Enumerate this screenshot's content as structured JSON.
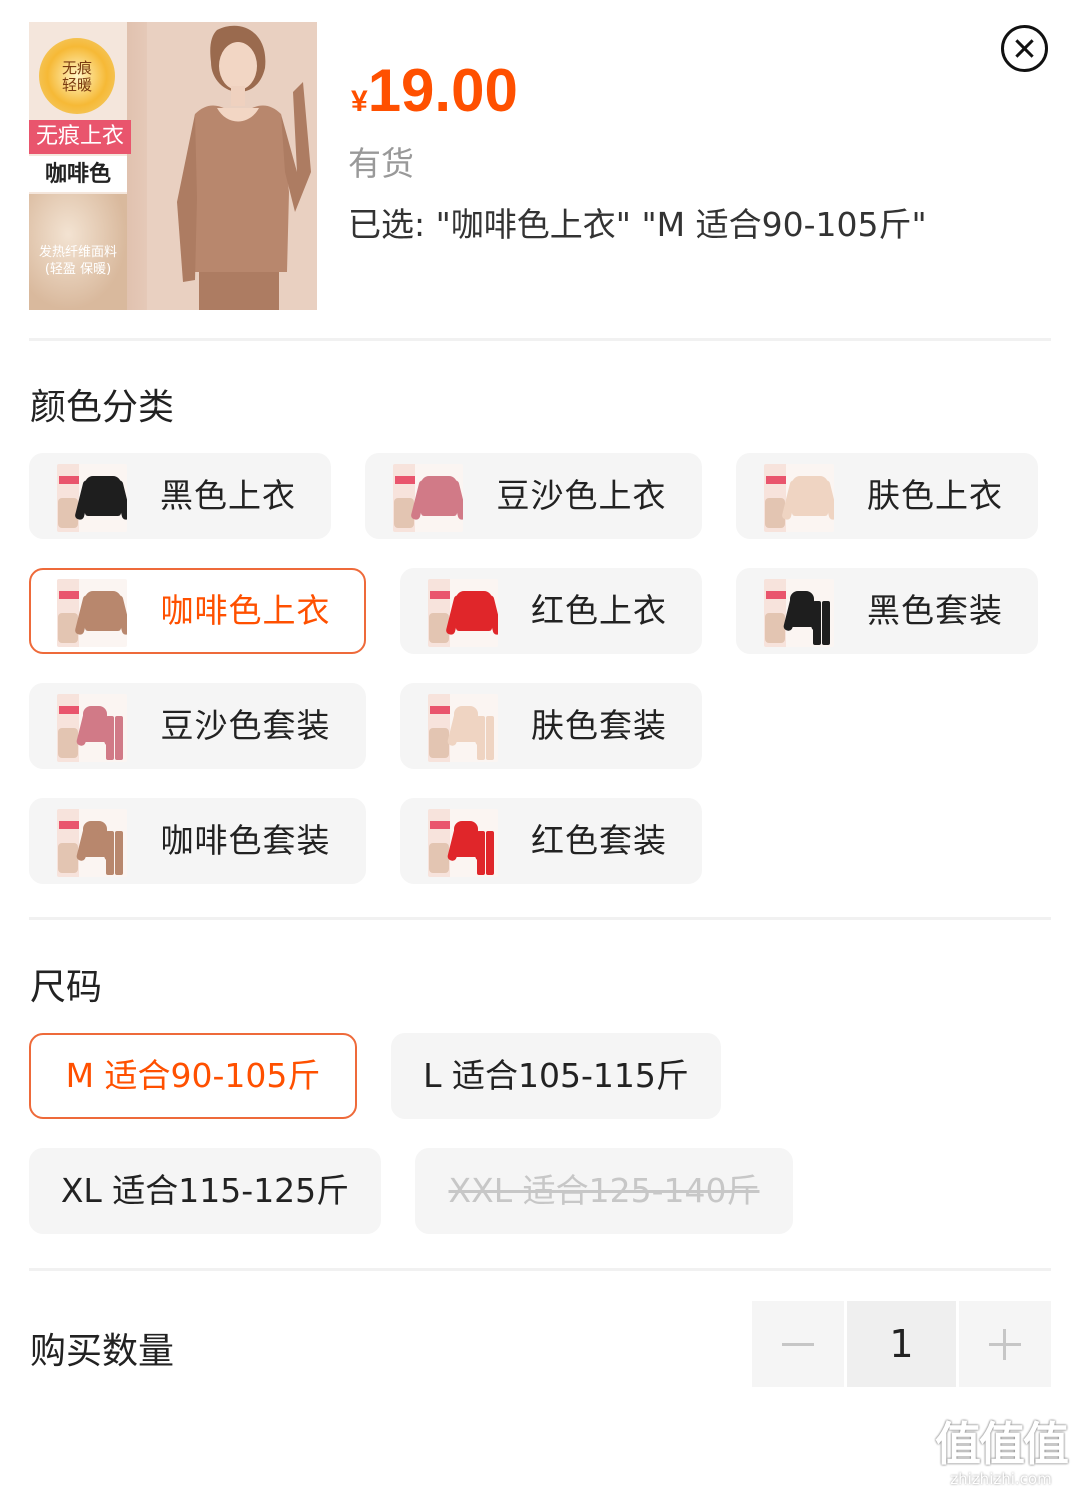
{
  "product": {
    "thumb_badge": "无痕\n轻暖",
    "thumb_tag": "无痕上衣",
    "thumb_color": "咖啡色",
    "thumb_fabric_text": "发热纤维面料\n(轻盈 保暖)",
    "price_currency": "¥",
    "price_value": "19.00",
    "stock": "有货",
    "selected": "已选: \"咖啡色上衣\" \"M 适合90-105斤\""
  },
  "colors": {
    "accent": "#ff5000",
    "accent_border": "#ee6a3a",
    "chip_bg": "#f5f5f5"
  },
  "color_section": {
    "title": "颜色分类",
    "options": [
      {
        "label": "黑色上衣",
        "swatch": "#1e1e1e",
        "kind": "top",
        "active": false
      },
      {
        "label": "豆沙色上衣",
        "swatch": "#d17a87",
        "kind": "top",
        "active": false
      },
      {
        "label": "肤色上衣",
        "swatch": "#efd4c2",
        "kind": "top",
        "active": false
      },
      {
        "label": "咖啡色上衣",
        "swatch": "#b8876d",
        "kind": "top",
        "active": true
      },
      {
        "label": "红色上衣",
        "swatch": "#e0262a",
        "kind": "top",
        "active": false
      },
      {
        "label": "黑色套装",
        "swatch": "#1e1e1e",
        "kind": "set",
        "active": false
      },
      {
        "label": "豆沙色套装",
        "swatch": "#d17a87",
        "kind": "set",
        "active": false
      },
      {
        "label": "肤色套装",
        "swatch": "#efd4c2",
        "kind": "set",
        "active": false
      },
      {
        "label": "咖啡色套装",
        "swatch": "#b8876d",
        "kind": "set",
        "active": false
      },
      {
        "label": "红色套装",
        "swatch": "#e0262a",
        "kind": "set",
        "active": false
      }
    ]
  },
  "size_section": {
    "title": "尺码",
    "options": [
      {
        "label": "M 适合90-105斤",
        "state": "selected"
      },
      {
        "label": "L 适合105-115斤",
        "state": "available"
      },
      {
        "label": "XL 适合115-125斤",
        "state": "available"
      },
      {
        "label": "XXL 适合125-140斤",
        "state": "unavailable"
      }
    ]
  },
  "quantity_section": {
    "title": "购买数量",
    "value": "1",
    "decrement_icon": "minus-icon",
    "increment_icon": "plus-icon"
  },
  "close_icon": "close-circle-icon",
  "watermark": {
    "logo": "值值值",
    "url": "zhizhizhi.com"
  }
}
